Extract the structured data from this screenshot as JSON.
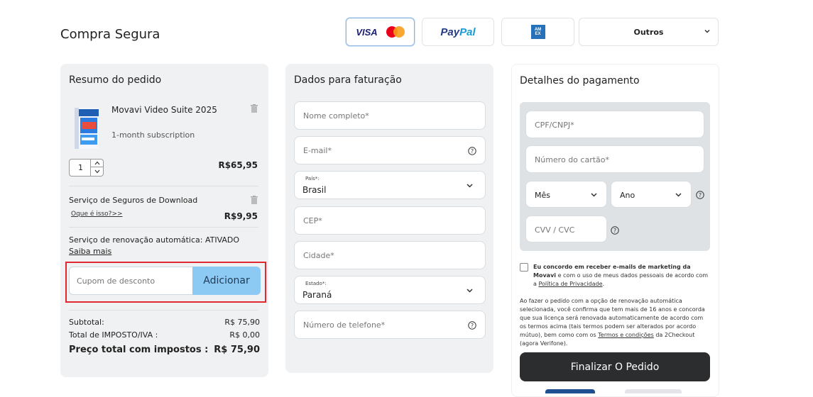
{
  "page": {
    "title": "Compra Segura"
  },
  "payment_methods": {
    "visa": "VISA",
    "paypal_pay": "Pay",
    "paypal_pal": "Pal",
    "others": "Outros"
  },
  "order_summary": {
    "heading": "Resumo do pedido",
    "product_name": "Movavi Video Suite 2025",
    "product_subtitle": "1-month subscription",
    "quantity": "1",
    "product_price": "R$65,95",
    "insurance_label": "Serviço de Seguros de Download",
    "insurance_link": "Oque é isso?>>",
    "insurance_price": "R$9,95",
    "renewal_text": "Serviço de renovação automática: ATIVADO",
    "learn_more": "Saiba mais",
    "coupon_placeholder": "Cupom de desconto",
    "coupon_button": "Adicionar",
    "subtotal_label": "Subtotal:",
    "subtotal_value": "R$ 75,90",
    "tax_label": "Total de IMPOSTO/IVA :",
    "tax_value": "R$ 0,00",
    "total_label": "Preço total com impostos :",
    "total_value": "R$ 75,90"
  },
  "billing": {
    "heading": "Dados para faturação",
    "full_name_placeholder": "Nome completo*",
    "email_placeholder": "E-mail*",
    "country_label": "País*:",
    "country_value": "Brasil",
    "zip_placeholder": "CEP*",
    "city_placeholder": "Cidade*",
    "state_label": "Estado*:",
    "state_value": "Paraná",
    "phone_placeholder": "Número de telefone*"
  },
  "payment": {
    "heading": "Detalhes do pagamento",
    "cpf_placeholder": "CPF/CNPJ*",
    "card_placeholder": "Número do cartão*",
    "month_label": "Mês",
    "year_label": "Ano",
    "cvv_placeholder": "CVV / CVC",
    "consent_bold": "Eu concordo em receber e-mails de marketing da Movavi",
    "consent_text": " e com o uso de meus dados pessoais de acordo com a ",
    "privacy_link": "Política de Privacidade",
    "consent_end": ".",
    "legal_text": "Ao fazer o pedido com a opção de renovação automática selecionada, você confirma que tem mais de 16 anos e concorda que sua licença será renovada automaticamente de acordo com os termos acima (tais termos podem ser alterados por acordo mútuo), bem como com os ",
    "terms_link": "Termos e condições",
    "legal_end": " da 2Checkout (agora Verifone).",
    "submit_button": "Finalizar O Pedido"
  }
}
